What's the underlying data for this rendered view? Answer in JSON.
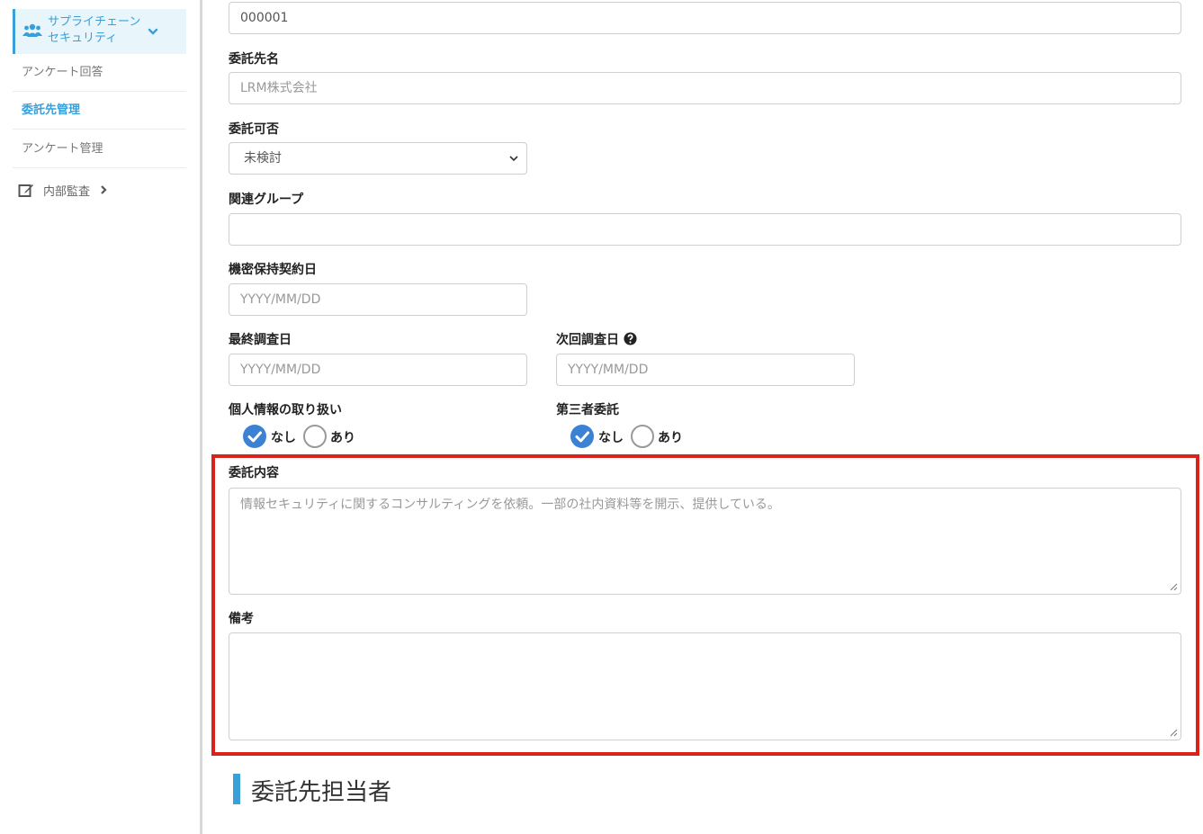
{
  "sidebar": {
    "active_group": {
      "label": "サプライチェーン\nセキュリティ",
      "icon": "users-icon"
    },
    "items": [
      {
        "label": "アンケート回答",
        "current": false
      },
      {
        "label": "委託先管理",
        "current": true
      },
      {
        "label": "アンケート管理",
        "current": false
      }
    ],
    "audit": {
      "label": "内部監査",
      "icon": "edit-icon"
    }
  },
  "form": {
    "code_value": "000001",
    "contractor_name": {
      "label": "委託先名",
      "placeholder": "LRM株式会社"
    },
    "approval": {
      "label": "委託可否",
      "value": "未検討"
    },
    "related_group": {
      "label": "関連グループ",
      "value": ""
    },
    "nda_date": {
      "label": "機密保持契約日",
      "placeholder": "YYYY/MM/DD"
    },
    "last_survey": {
      "label": "最終調査日",
      "placeholder": "YYYY/MM/DD"
    },
    "next_survey": {
      "label": "次回調査日",
      "placeholder": "YYYY/MM/DD"
    },
    "personal_info": {
      "label": "個人情報の取り扱い",
      "options": [
        "なし",
        "あり"
      ],
      "selected": "なし"
    },
    "third_party": {
      "label": "第三者委託",
      "options": [
        "なし",
        "あり"
      ],
      "selected": "なし"
    },
    "contents": {
      "label": "委託内容",
      "placeholder": "情報セキュリティに関するコンサルティングを依頼。一部の社内資料等を開示、提供している。"
    },
    "notes": {
      "label": "備考",
      "value": ""
    }
  },
  "section": {
    "title": "委託先担当者"
  },
  "colors": {
    "accent": "#3aa0d8",
    "highlight": "#d9221c",
    "radio_checked": "#3b82d4"
  }
}
